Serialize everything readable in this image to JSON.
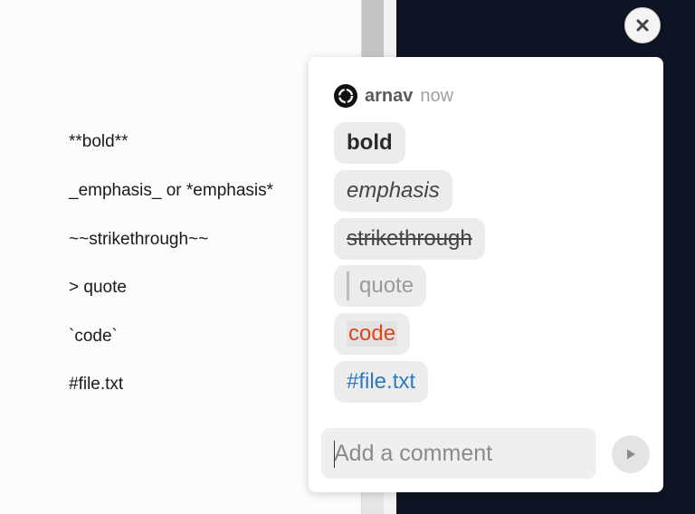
{
  "document": {
    "lines": [
      "**bold**",
      "_emphasis_ or *emphasis*",
      "~~strikethrough~~",
      "> quote",
      "`code`",
      "#file.txt"
    ]
  },
  "close_button": {
    "icon": "close-icon"
  },
  "comment": {
    "author": "arnav",
    "time": "now",
    "avatar_icon": "avatar-logo-icon",
    "chips": {
      "bold": "bold",
      "emphasis": "emphasis",
      "strikethrough": "strikethrough",
      "quote": "quote",
      "code": "code",
      "file": "#file.txt"
    },
    "code_color": "#e0441a",
    "file_color": "#2e79c2"
  },
  "composer": {
    "placeholder": "Add a comment",
    "value": "",
    "send_icon": "send-icon"
  },
  "colors": {
    "dark_panel": "#0f1424",
    "chip_bg": "#ececec"
  }
}
